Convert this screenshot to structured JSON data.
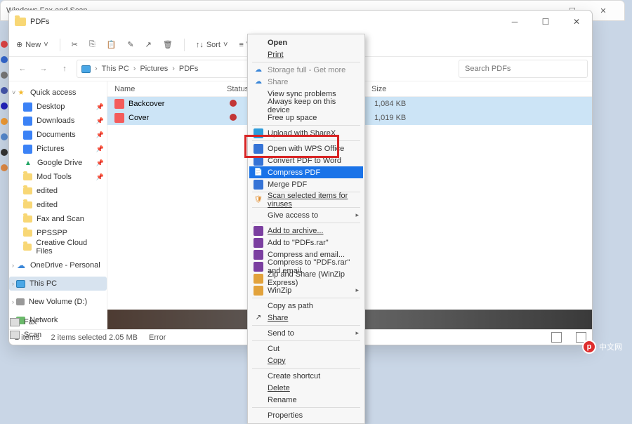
{
  "bg_window": {
    "title": "Windows Fax and Scan"
  },
  "explorer": {
    "title": "PDFs",
    "toolbar": {
      "new": "New",
      "sort": "Sort",
      "view": "View"
    },
    "breadcrumb": {
      "a": "This PC",
      "b": "Pictures",
      "c": "PDFs"
    },
    "search_placeholder": "Search PDFs",
    "columns": {
      "name": "Name",
      "status": "Status",
      "size": "Size"
    },
    "rows": [
      {
        "name": "Backcover",
        "size": "1,084 KB"
      },
      {
        "name": "Cover",
        "size": "1,019 KB"
      }
    ],
    "statusbar": {
      "count": "2 items",
      "sel": "2 items selected  2.05 MB",
      "error": "Error"
    }
  },
  "sidebar": {
    "quick": "Quick access",
    "items": [
      "Desktop",
      "Downloads",
      "Documents",
      "Pictures",
      "Google Drive",
      "Mod Tools",
      "edited",
      "edited",
      "Fax and Scan",
      "PPSSPP",
      "Creative Cloud Files"
    ],
    "onedrive": "OneDrive - Personal",
    "thispc": "This PC",
    "newvol": "New Volume (D:)",
    "network": "Network"
  },
  "context": {
    "open": "Open",
    "print": "Print",
    "storage": "Storage full - Get more",
    "share_od": "Share",
    "sync": "View sync problems",
    "keep": "Always keep on this device",
    "free": "Free up space",
    "sharex": "Upload with ShareX",
    "wps": "Open with WPS Office",
    "toword": "Convert PDF to Word",
    "compress": "Compress PDF",
    "merge": "Merge PDF",
    "scan": "Scan selected items for viruses",
    "access": "Give access to",
    "addarch": "Add to archive...",
    "addpdfs": "Add to \"PDFs.rar\"",
    "compemail": "Compress and email...",
    "comprar": "Compress to \"PDFs.rar\" and email",
    "zipshare": "Zip and Share (WinZip Express)",
    "winzip": "WinZip",
    "copypath": "Copy as path",
    "share": "Share",
    "sendto": "Send to",
    "cut": "Cut",
    "copy": "Copy",
    "shortcut": "Create shortcut",
    "delete": "Delete",
    "rename": "Rename",
    "properties": "Properties"
  },
  "left_panel": {
    "a": "Fax",
    "b": "Scan"
  },
  "watermark": "中文网"
}
